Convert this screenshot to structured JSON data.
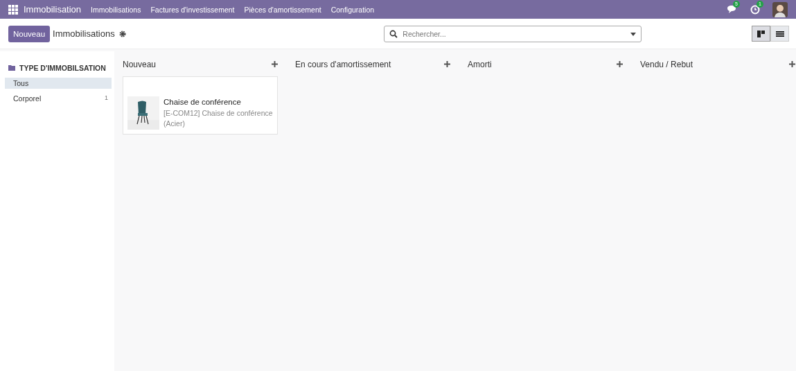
{
  "navbar": {
    "app_name": "Immobilisation",
    "menu": [
      "Immobilisations",
      "Factures d'investissement",
      "Pièces d'amortissement",
      "Configuration"
    ],
    "messages_count": "5",
    "activities_count": "1"
  },
  "control_panel": {
    "new_button": "Nouveau",
    "breadcrumb": "Immobilisations",
    "search": {
      "placeholder": "Rechercher..."
    },
    "views": [
      {
        "kind": "kanban",
        "selected": true
      },
      {
        "kind": "list",
        "selected": false
      }
    ]
  },
  "sidebar": {
    "title": "TYPE D'IMMOBILSATION",
    "items": [
      {
        "label": "Tous",
        "selected": true
      },
      {
        "label": "Corporel",
        "count": "1",
        "selected": false
      }
    ]
  },
  "columns": [
    {
      "title": "Nouveau",
      "cards": [
        {
          "title": "Chaise de conférence",
          "subtitle": "[E-COM12] Chaise de conférence (Acier)"
        }
      ]
    },
    {
      "title": "En cours d'amortissement"
    },
    {
      "title": "Amorti"
    },
    {
      "title": "Vendu / Rebut"
    }
  ]
}
